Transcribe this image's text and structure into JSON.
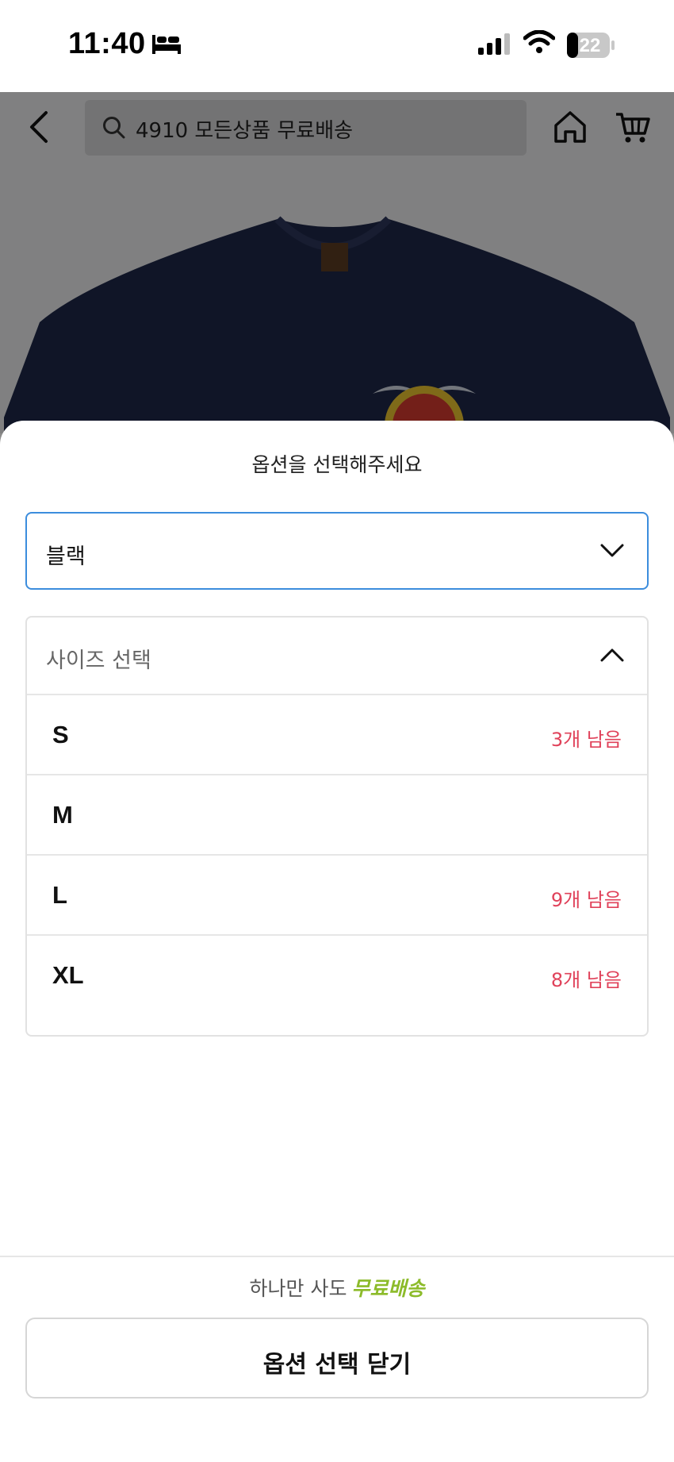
{
  "status_bar": {
    "time": "11:40",
    "battery": "22",
    "icons": [
      "bed-icon",
      "cellular-signal-icon",
      "wifi-icon",
      "battery-icon"
    ]
  },
  "background_page": {
    "search_placeholder": "4910 모든상품 무료배송",
    "icons": [
      "back-arrow-icon",
      "search-icon",
      "home-icon",
      "cart-icon"
    ]
  },
  "sheet": {
    "title": "옵션을 선택해주세요",
    "color_select": {
      "value": "블랙",
      "icon": "chevron-down-icon"
    },
    "size_select": {
      "placeholder": "사이즈 선택",
      "icon": "chevron-up-icon",
      "options": [
        {
          "size": "S",
          "stock": "3개 남음"
        },
        {
          "size": "M",
          "stock": ""
        },
        {
          "size": "L",
          "stock": "9개 남음"
        },
        {
          "size": "XL",
          "stock": "8개 남음"
        }
      ]
    },
    "promo": {
      "text": "하나만 사도",
      "highlight": "무료배송"
    },
    "close_button": "옵션 선택 닫기"
  },
  "colors": {
    "accent_border": "#3c8ddd",
    "stock_text": "#e0425a",
    "free_shipping": "#8cbb2a"
  }
}
